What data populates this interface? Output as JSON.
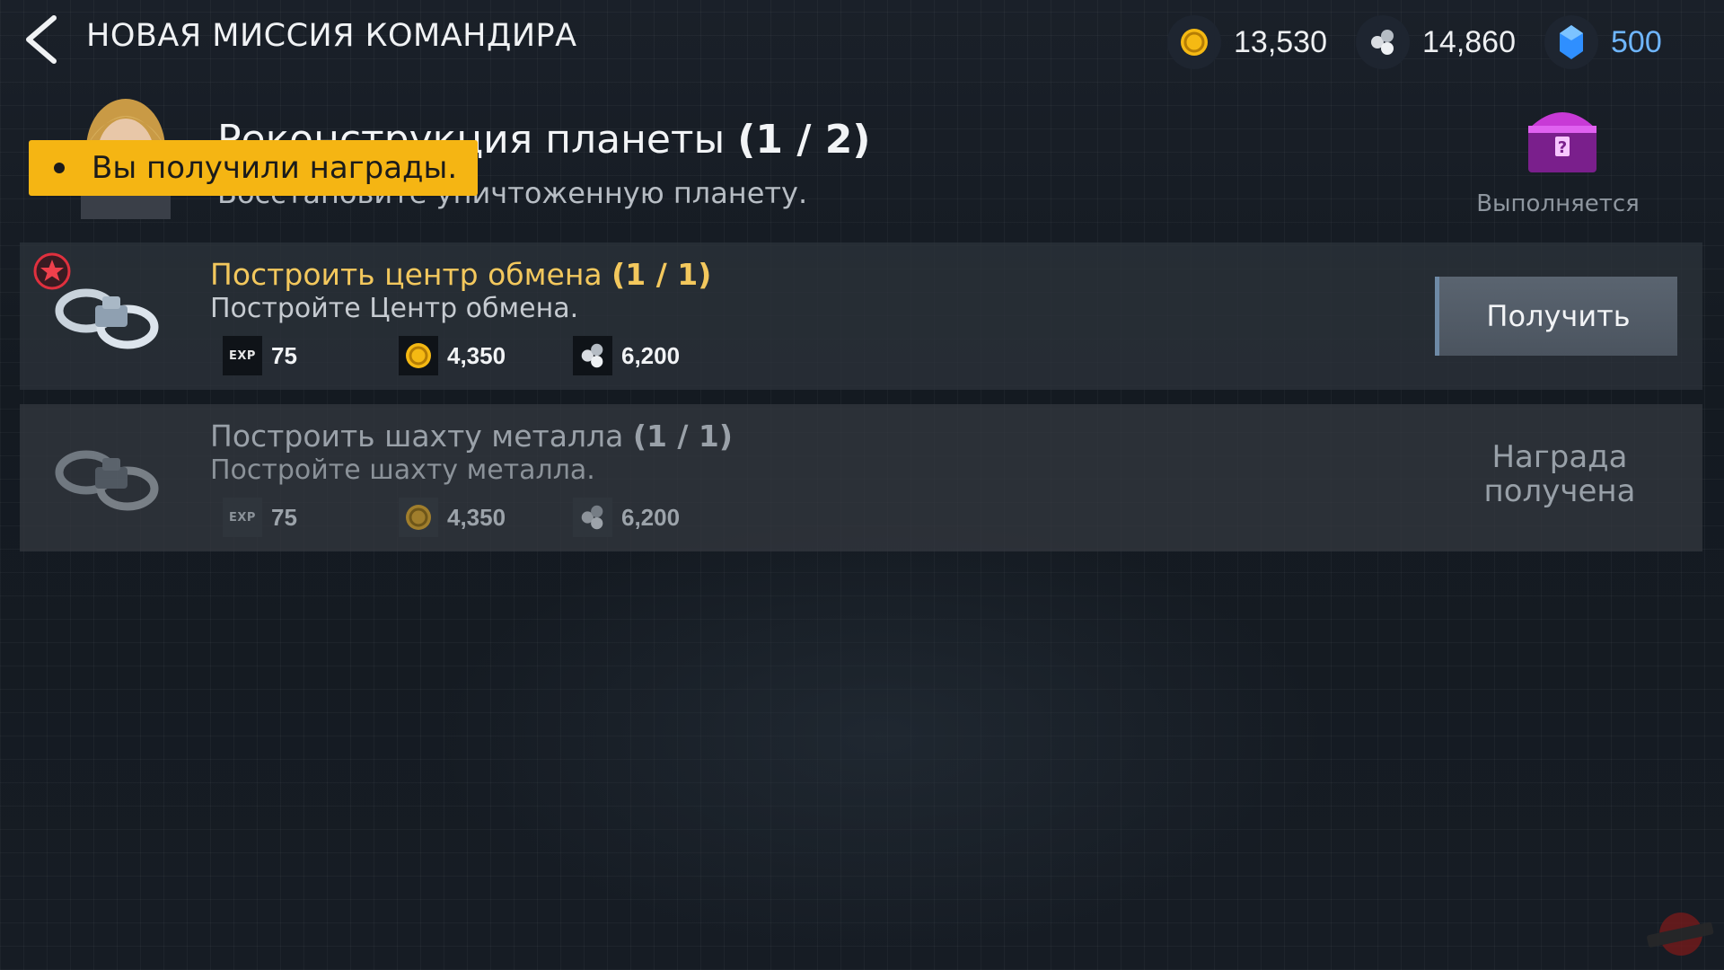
{
  "header": {
    "title": "НОВАЯ МИССИЯ КОМАНДИРА",
    "resources": {
      "gold": "13,530",
      "metal": "14,860",
      "crystal": "500"
    }
  },
  "mission": {
    "title_main": "Реконструкция планеты",
    "title_progress": "(1 / 2)",
    "description": "Восстановите уничтоженную планету.",
    "chest_status": "Выполняется"
  },
  "toast": {
    "text": "Вы получили награды."
  },
  "tasks": [
    {
      "title": "Построить центр обмена",
      "progress": "(1 / 1)",
      "description": "Постройте Центр обмена.",
      "rewards": {
        "exp_label": "EXP",
        "exp": "75",
        "gold": "4,350",
        "metal": "6,200"
      },
      "action_label": "Получить"
    },
    {
      "title": "Построить шахту металла",
      "progress": "(1 / 1)",
      "description": "Постройте шахту металла.",
      "rewards": {
        "exp_label": "EXP",
        "exp": "75",
        "gold": "4,350",
        "metal": "6,200"
      },
      "status_label": "Награда получена"
    }
  ],
  "colors": {
    "accent_gold": "#f3c85d",
    "toast_bg": "#f5b513",
    "crystal": "#6fb6ff"
  },
  "icons": [
    "back-arrow-icon",
    "gold-coin-icon",
    "metal-icon",
    "crystal-icon",
    "chest-icon",
    "star-badge-icon",
    "ring-building-icon",
    "watermark-logo"
  ]
}
